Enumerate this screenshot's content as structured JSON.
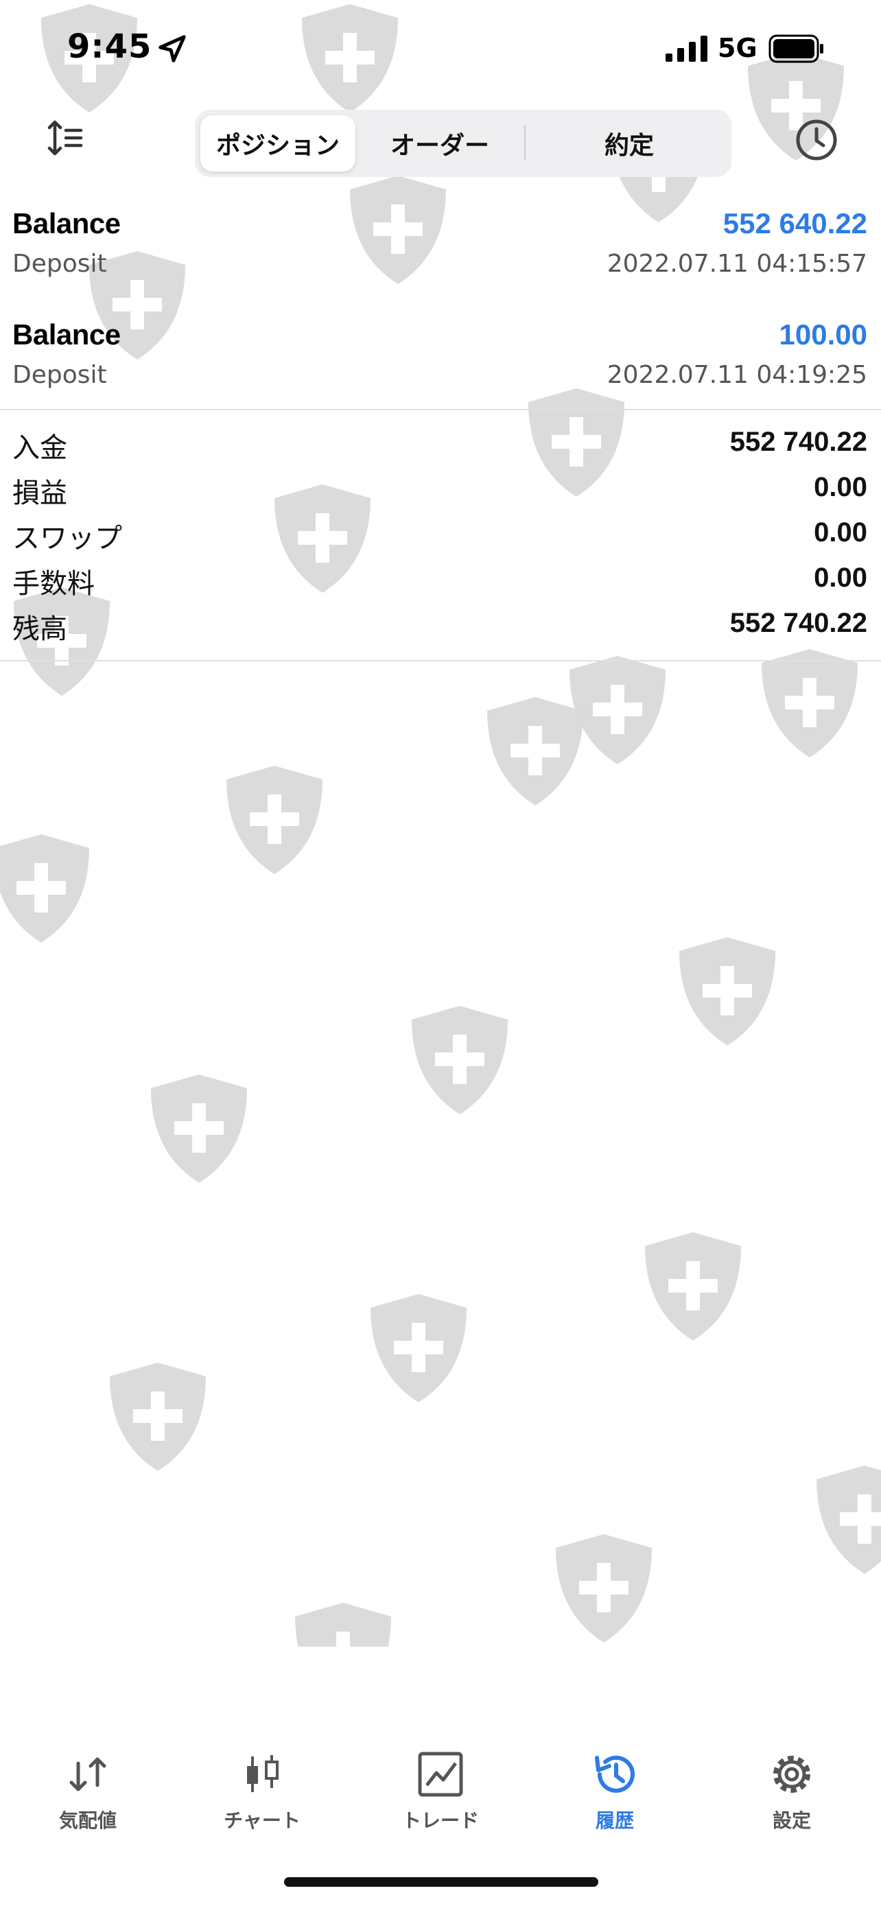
{
  "status": {
    "time": "9:45",
    "network": "5G"
  },
  "tabs_top": {
    "positions": "ポジション",
    "orders": "オーダー",
    "deals": "約定"
  },
  "deals": [
    {
      "title": "Balance",
      "amount": "552 640.22",
      "type": "Deposit",
      "datetime": "2022.07.11 04:15:57"
    },
    {
      "title": "Balance",
      "amount": "100.00",
      "type": "Deposit",
      "datetime": "2022.07.11 04:19:25"
    }
  ],
  "summary": [
    {
      "label": "入金",
      "value": "552 740.22"
    },
    {
      "label": "損益",
      "value": "0.00"
    },
    {
      "label": "スワップ",
      "value": "0.00"
    },
    {
      "label": "手数料",
      "value": "0.00"
    },
    {
      "label": "残高",
      "value": "552 740.22"
    }
  ],
  "tabbar": [
    {
      "label": "気配値",
      "icon": "quotes-icon"
    },
    {
      "label": "チャート",
      "icon": "chart-candles-icon"
    },
    {
      "label": "トレード",
      "icon": "trade-icon"
    },
    {
      "label": "履歴",
      "icon": "history-icon",
      "active": true
    },
    {
      "label": "設定",
      "icon": "settings-icon"
    }
  ],
  "colors": {
    "accent": "#2e7be5",
    "watermark": "#d9d9d9"
  }
}
